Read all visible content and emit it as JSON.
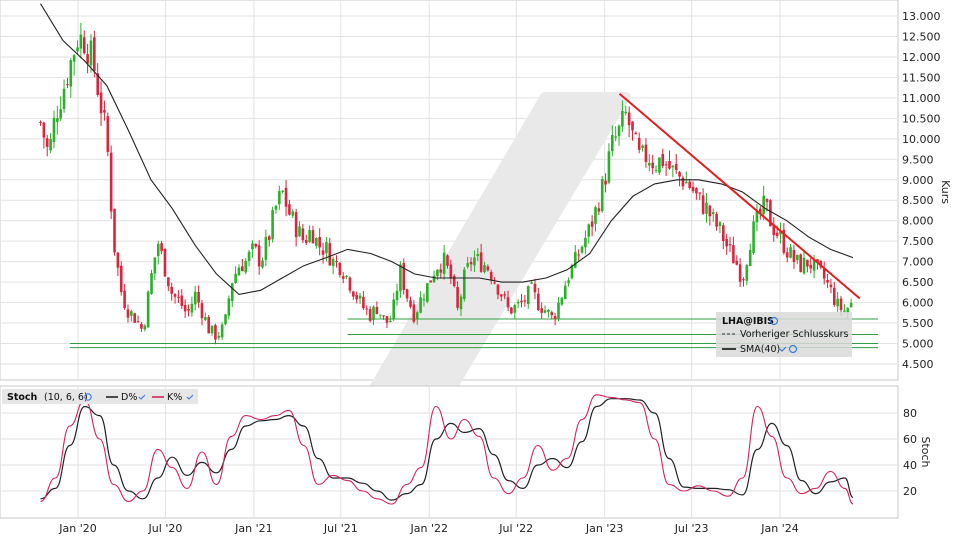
{
  "chart_data": [
    {
      "type": "candlestick",
      "ylabel": "Kurs",
      "ylim": [
        4.0,
        13.3
      ],
      "y_ticks": [
        "13.000",
        "12.500",
        "12.000",
        "11.500",
        "11.000",
        "10.500",
        "10.000",
        "9.500",
        "9.000",
        "8.500",
        "8.000",
        "7.500",
        "7.000",
        "6.500",
        "6.000",
        "5.500",
        "5.000",
        "4.500"
      ],
      "x_ticks": [
        "Jan '20",
        "Jul '20",
        "Jan '21",
        "Jul '21",
        "Jan '22",
        "Jul '22",
        "Jan '23",
        "Jul '23",
        "Jan '24"
      ],
      "grid": true,
      "price_path": [
        [
          "2019-10-15",
          10.4
        ],
        [
          "2019-11-01",
          9.6
        ],
        [
          "2019-11-15",
          10.6
        ],
        [
          "2019-12-01",
          11.2
        ],
        [
          "2019-12-15",
          11.8
        ],
        [
          "2020-01-01",
          12.5
        ],
        [
          "2020-01-15",
          12.4
        ],
        [
          "2020-02-01",
          11.9
        ],
        [
          "2020-02-15",
          11.0
        ],
        [
          "2020-03-01",
          10.0
        ],
        [
          "2020-03-15",
          7.5
        ],
        [
          "2020-04-01",
          6.2
        ],
        [
          "2020-04-15",
          5.8
        ],
        [
          "2020-05-01",
          5.6
        ],
        [
          "2020-05-15",
          5.3
        ],
        [
          "2020-06-01",
          6.6
        ],
        [
          "2020-06-15",
          7.5
        ],
        [
          "2020-07-01",
          6.8
        ],
        [
          "2020-07-15",
          6.2
        ],
        [
          "2020-08-01",
          6.0
        ],
        [
          "2020-08-15",
          5.7
        ],
        [
          "2020-09-01",
          6.2
        ],
        [
          "2020-09-15",
          5.8
        ],
        [
          "2020-10-01",
          5.3
        ],
        [
          "2020-10-15",
          5.2
        ],
        [
          "2020-11-01",
          5.4
        ],
        [
          "2020-11-15",
          6.5
        ],
        [
          "2020-12-01",
          6.9
        ],
        [
          "2020-12-15",
          7.0
        ],
        [
          "2021-01-01",
          7.3
        ],
        [
          "2021-01-15",
          7.0
        ],
        [
          "2021-02-01",
          7.6
        ],
        [
          "2021-02-15",
          8.3
        ],
        [
          "2021-03-01",
          8.7
        ],
        [
          "2021-03-15",
          8.2
        ],
        [
          "2021-04-01",
          7.8
        ],
        [
          "2021-04-15",
          7.5
        ],
        [
          "2021-05-01",
          7.8
        ],
        [
          "2021-05-15",
          7.4
        ],
        [
          "2021-06-01",
          7.3
        ],
        [
          "2021-06-15",
          7.0
        ],
        [
          "2021-07-01",
          6.9
        ],
        [
          "2021-07-15",
          6.6
        ],
        [
          "2021-08-01",
          6.2
        ],
        [
          "2021-08-15",
          5.9
        ],
        [
          "2021-09-01",
          5.7
        ],
        [
          "2021-09-15",
          5.9
        ],
        [
          "2021-10-01",
          5.5
        ],
        [
          "2021-10-15",
          5.6
        ],
        [
          "2021-11-01",
          6.8
        ],
        [
          "2021-11-15",
          6.2
        ],
        [
          "2021-12-01",
          5.7
        ],
        [
          "2021-12-15",
          6.1
        ],
        [
          "2022-01-01",
          6.5
        ],
        [
          "2022-01-15",
          6.9
        ],
        [
          "2022-02-01",
          7.0
        ],
        [
          "2022-02-15",
          6.6
        ],
        [
          "2022-03-01",
          5.8
        ],
        [
          "2022-03-15",
          6.6
        ],
        [
          "2022-04-01",
          7.1
        ],
        [
          "2022-04-15",
          7.0
        ],
        [
          "2022-05-01",
          6.9
        ],
        [
          "2022-05-15",
          6.6
        ],
        [
          "2022-06-01",
          6.2
        ],
        [
          "2022-06-15",
          5.8
        ],
        [
          "2022-07-01",
          5.9
        ],
        [
          "2022-07-15",
          6.0
        ],
        [
          "2022-08-01",
          6.3
        ],
        [
          "2022-08-15",
          6.0
        ],
        [
          "2022-09-01",
          5.8
        ],
        [
          "2022-09-15",
          5.6
        ],
        [
          "2022-10-01",
          6.1
        ],
        [
          "2022-10-15",
          6.6
        ],
        [
          "2022-11-01",
          7.0
        ],
        [
          "2022-11-15",
          7.4
        ],
        [
          "2022-12-01",
          7.8
        ],
        [
          "2022-12-15",
          8.3
        ],
        [
          "2023-01-01",
          9.0
        ],
        [
          "2023-01-15",
          9.8
        ],
        [
          "2023-02-01",
          10.2
        ],
        [
          "2023-02-15",
          10.6
        ],
        [
          "2023-03-01",
          10.0
        ],
        [
          "2023-03-15",
          9.5
        ],
        [
          "2023-04-01",
          9.6
        ],
        [
          "2023-04-15",
          9.4
        ],
        [
          "2023-05-01",
          9.5
        ],
        [
          "2023-05-15",
          9.3
        ],
        [
          "2023-06-01",
          9.1
        ],
        [
          "2023-06-15",
          9.0
        ],
        [
          "2023-07-01",
          8.8
        ],
        [
          "2023-07-15",
          8.5
        ],
        [
          "2023-08-01",
          8.3
        ],
        [
          "2023-08-15",
          8.0
        ],
        [
          "2023-09-01",
          7.7
        ],
        [
          "2023-09-15",
          7.3
        ],
        [
          "2023-10-01",
          7.0
        ],
        [
          "2023-10-15",
          6.6
        ],
        [
          "2023-11-01",
          7.6
        ],
        [
          "2023-11-15",
          8.0
        ],
        [
          "2023-12-01",
          8.4
        ],
        [
          "2023-12-15",
          7.9
        ],
        [
          "2024-01-01",
          7.6
        ],
        [
          "2024-01-15",
          7.3
        ],
        [
          "2024-02-01",
          7.0
        ],
        [
          "2024-02-15",
          6.9
        ],
        [
          "2024-03-01",
          7.0
        ],
        [
          "2024-03-15",
          6.8
        ],
        [
          "2024-04-01",
          6.6
        ],
        [
          "2024-04-15",
          6.3
        ],
        [
          "2024-05-01",
          5.9
        ],
        [
          "2024-05-15",
          5.8
        ],
        [
          "2024-06-01",
          6.0
        ]
      ],
      "sma_path": [
        [
          "2019-10-15",
          13.3
        ],
        [
          "2019-12-01",
          12.4
        ],
        [
          "2020-01-15",
          11.9
        ],
        [
          "2020-03-01",
          11.3
        ],
        [
          "2020-04-15",
          10.2
        ],
        [
          "2020-06-01",
          9.0
        ],
        [
          "2020-07-15",
          8.3
        ],
        [
          "2020-09-01",
          7.4
        ],
        [
          "2020-10-15",
          6.7
        ],
        [
          "2020-12-01",
          6.2
        ],
        [
          "2021-01-15",
          6.3
        ],
        [
          "2021-03-01",
          6.6
        ],
        [
          "2021-04-15",
          6.9
        ],
        [
          "2021-06-01",
          7.1
        ],
        [
          "2021-07-15",
          7.3
        ],
        [
          "2021-09-01",
          7.2
        ],
        [
          "2021-10-15",
          7.0
        ],
        [
          "2021-12-01",
          6.7
        ],
        [
          "2022-01-15",
          6.6
        ],
        [
          "2022-03-01",
          6.6
        ],
        [
          "2022-04-15",
          6.6
        ],
        [
          "2022-06-01",
          6.5
        ],
        [
          "2022-07-15",
          6.5
        ],
        [
          "2022-09-01",
          6.6
        ],
        [
          "2022-10-15",
          6.8
        ],
        [
          "2022-12-01",
          7.2
        ],
        [
          "2023-01-15",
          8.0
        ],
        [
          "2023-03-01",
          8.6
        ],
        [
          "2023-04-15",
          8.9
        ],
        [
          "2023-06-01",
          9.0
        ],
        [
          "2023-07-15",
          9.0
        ],
        [
          "2023-09-01",
          8.9
        ],
        [
          "2023-10-15",
          8.7
        ],
        [
          "2023-12-01",
          8.3
        ],
        [
          "2024-01-15",
          8.0
        ],
        [
          "2024-03-01",
          7.6
        ],
        [
          "2024-04-15",
          7.3
        ],
        [
          "2024-06-01",
          7.1
        ]
      ],
      "trendline": [
        [
          "2023-02-01",
          11.1
        ],
        [
          "2024-06-15",
          6.1
        ]
      ],
      "horizontal_levels": [
        {
          "value": 5.6,
          "from": "2021-07-15"
        },
        {
          "value": 5.22,
          "from": "2021-07-15"
        },
        {
          "value": 5.0,
          "from": "2019-12-15"
        },
        {
          "value": 4.9,
          "from": "2019-12-15"
        }
      ],
      "legend": {
        "symbol": "LHA@IBIS",
        "items": [
          "Vorheriger Schlusskurs",
          "SMA(40)"
        ],
        "placement": "bottom-right"
      }
    },
    {
      "type": "line",
      "title": "Stoch",
      "params": "(10, 6, 6)",
      "ylabel": "Stoch",
      "ylim": [
        5,
        97
      ],
      "y_ticks": [
        "80",
        "60",
        "40",
        "20"
      ],
      "series": [
        {
          "name": "D%",
          "color": "#222222",
          "values": [
            [
              "2019-10-15",
              14
            ],
            [
              "2019-11-15",
              22
            ],
            [
              "2019-12-15",
              55
            ],
            [
              "2020-01-15",
              85
            ],
            [
              "2020-02-15",
              78
            ],
            [
              "2020-03-15",
              40
            ],
            [
              "2020-04-15",
              20
            ],
            [
              "2020-05-15",
              14
            ],
            [
              "2020-06-15",
              30
            ],
            [
              "2020-07-15",
              46
            ],
            [
              "2020-08-15",
              32
            ],
            [
              "2020-09-15",
              42
            ],
            [
              "2020-10-15",
              34
            ],
            [
              "2020-11-15",
              52
            ],
            [
              "2020-12-15",
              70
            ],
            [
              "2021-01-15",
              74
            ],
            [
              "2021-02-15",
              75
            ],
            [
              "2021-03-15",
              78
            ],
            [
              "2021-04-15",
              70
            ],
            [
              "2021-05-15",
              45
            ],
            [
              "2021-06-15",
              30
            ],
            [
              "2021-07-15",
              30
            ],
            [
              "2021-08-15",
              26
            ],
            [
              "2021-09-15",
              20
            ],
            [
              "2021-10-15",
              13
            ],
            [
              "2021-11-15",
              18
            ],
            [
              "2021-12-15",
              25
            ],
            [
              "2022-01-15",
              60
            ],
            [
              "2022-02-15",
              72
            ],
            [
              "2022-03-15",
              65
            ],
            [
              "2022-04-15",
              68
            ],
            [
              "2022-05-15",
              48
            ],
            [
              "2022-06-15",
              28
            ],
            [
              "2022-07-15",
              22
            ],
            [
              "2022-08-15",
              40
            ],
            [
              "2022-09-15",
              45
            ],
            [
              "2022-10-15",
              38
            ],
            [
              "2022-11-15",
              58
            ],
            [
              "2022-12-15",
              85
            ],
            [
              "2023-01-15",
              91
            ],
            [
              "2023-02-15",
              91
            ],
            [
              "2023-03-15",
              90
            ],
            [
              "2023-04-15",
              80
            ],
            [
              "2023-05-15",
              45
            ],
            [
              "2023-06-15",
              23
            ],
            [
              "2023-07-15",
              22
            ],
            [
              "2023-08-15",
              22
            ],
            [
              "2023-09-15",
              21
            ],
            [
              "2023-10-15",
              17
            ],
            [
              "2023-11-15",
              52
            ],
            [
              "2023-12-15",
              72
            ],
            [
              "2024-01-15",
              55
            ],
            [
              "2024-02-15",
              28
            ],
            [
              "2024-03-15",
              18
            ],
            [
              "2024-04-15",
              27
            ],
            [
              "2024-05-15",
              30
            ],
            [
              "2024-06-01",
              15
            ]
          ]
        },
        {
          "name": "K%",
          "color": "#d2265a",
          "values": [
            [
              "2019-10-15",
              12
            ],
            [
              "2019-11-15",
              30
            ],
            [
              "2019-12-15",
              70
            ],
            [
              "2020-01-15",
              90
            ],
            [
              "2020-02-15",
              60
            ],
            [
              "2020-03-15",
              25
            ],
            [
              "2020-04-15",
              12
            ],
            [
              "2020-05-15",
              20
            ],
            [
              "2020-06-15",
              52
            ],
            [
              "2020-07-15",
              38
            ],
            [
              "2020-08-15",
              22
            ],
            [
              "2020-09-15",
              50
            ],
            [
              "2020-10-15",
              25
            ],
            [
              "2020-11-15",
              62
            ],
            [
              "2020-12-15",
              78
            ],
            [
              "2021-01-15",
              75
            ],
            [
              "2021-02-15",
              78
            ],
            [
              "2021-03-15",
              82
            ],
            [
              "2021-04-15",
              55
            ],
            [
              "2021-05-15",
              25
            ],
            [
              "2021-06-15",
              32
            ],
            [
              "2021-07-15",
              28
            ],
            [
              "2021-08-15",
              20
            ],
            [
              "2021-09-15",
              14
            ],
            [
              "2021-10-15",
              10
            ],
            [
              "2021-11-15",
              25
            ],
            [
              "2021-12-15",
              38
            ],
            [
              "2022-01-15",
              85
            ],
            [
              "2022-02-15",
              60
            ],
            [
              "2022-03-15",
              75
            ],
            [
              "2022-04-15",
              62
            ],
            [
              "2022-05-15",
              30
            ],
            [
              "2022-06-15",
              18
            ],
            [
              "2022-07-15",
              30
            ],
            [
              "2022-08-15",
              55
            ],
            [
              "2022-09-15",
              36
            ],
            [
              "2022-10-15",
              45
            ],
            [
              "2022-11-15",
              75
            ],
            [
              "2022-12-15",
              94
            ],
            [
              "2023-01-15",
              92
            ],
            [
              "2023-02-15",
              90
            ],
            [
              "2023-03-15",
              88
            ],
            [
              "2023-04-15",
              60
            ],
            [
              "2023-05-15",
              25
            ],
            [
              "2023-06-15",
              20
            ],
            [
              "2023-07-15",
              24
            ],
            [
              "2023-08-15",
              20
            ],
            [
              "2023-09-15",
              16
            ],
            [
              "2023-10-15",
              30
            ],
            [
              "2023-11-15",
              85
            ],
            [
              "2023-12-15",
              62
            ],
            [
              "2024-01-15",
              30
            ],
            [
              "2024-02-15",
              18
            ],
            [
              "2024-03-15",
              22
            ],
            [
              "2024-04-15",
              35
            ],
            [
              "2024-05-15",
              22
            ],
            [
              "2024-06-01",
              10
            ]
          ]
        }
      ],
      "legend": {
        "placement": "top-left"
      }
    }
  ]
}
